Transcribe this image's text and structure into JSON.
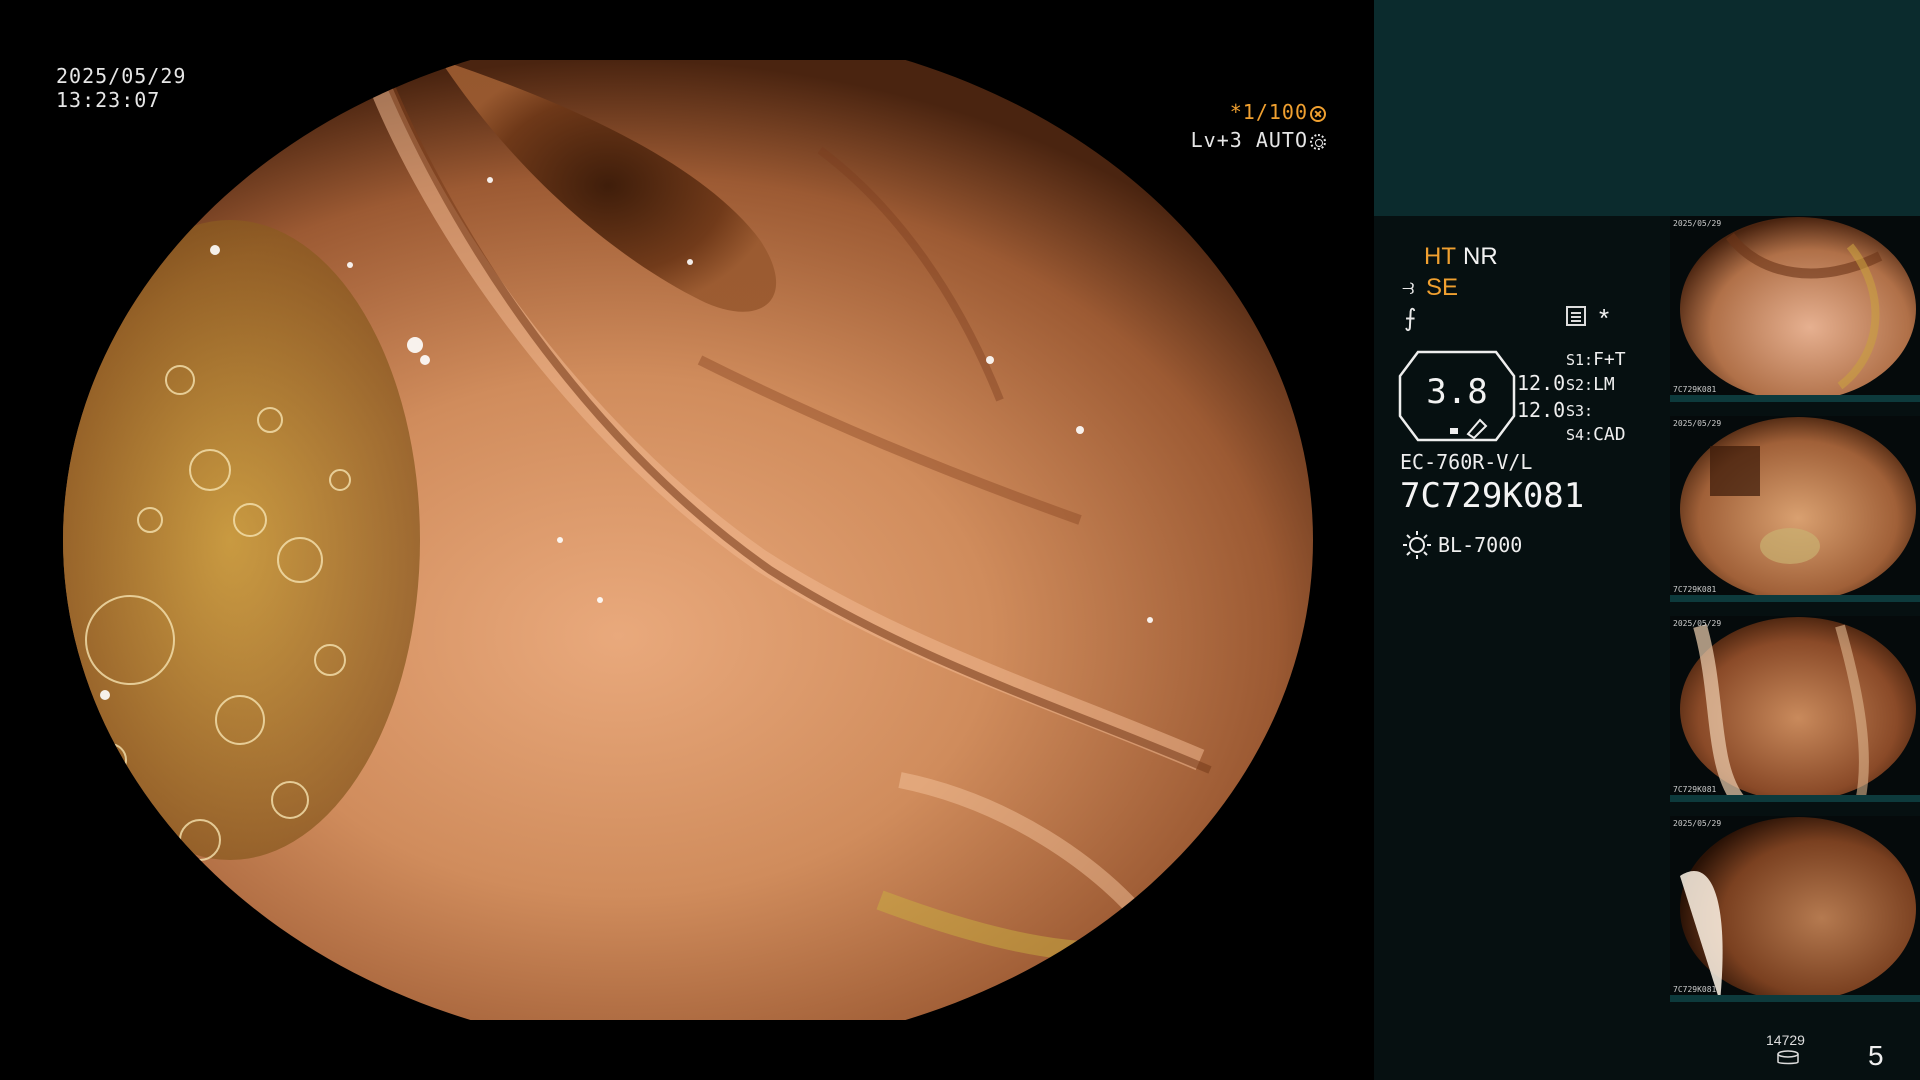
{
  "overlay": {
    "date": "2025/05/29",
    "time": "13:23:07",
    "shutter": "*1/100",
    "shutter_icon": "aperture-icon",
    "level": "Lv+3 AUTO",
    "level_icon": "iris-icon"
  },
  "panel": {
    "mode_ht": "HT",
    "mode_nr": "NR",
    "se_icon_glyph": "⥽",
    "se_label": "SE",
    "freeze_glyph": "⨍",
    "star": "*",
    "zoom_value": "3.8",
    "mag_top": "12.0",
    "mag_bottom": "12.0",
    "slots": [
      {
        "key": "S1:",
        "value": "F+T"
      },
      {
        "key": "S2:",
        "value": "LM"
      },
      {
        "key": "S3:",
        "value": ""
      },
      {
        "key": "S4:",
        "value": "CAD"
      }
    ],
    "scope_model": "EC-760R-V/L",
    "scope_serial": "7C729K081",
    "light_source": "BL-7000"
  },
  "thumbnails": [
    {
      "date": "2025/05/29",
      "serial": "7C729K081"
    },
    {
      "date": "2025/05/29",
      "serial": "7C729K081"
    },
    {
      "date": "2025/05/29",
      "serial": "7C729K081"
    },
    {
      "date": "2025/05/29",
      "serial": "7C729K081"
    }
  ],
  "footer": {
    "image_count": "14729",
    "page_number": "5"
  },
  "colors": {
    "accent_orange": "#f0a030",
    "panel_top": "#0b2b2d",
    "panel_bg": "#061011",
    "tissue": "#c98a5c"
  }
}
